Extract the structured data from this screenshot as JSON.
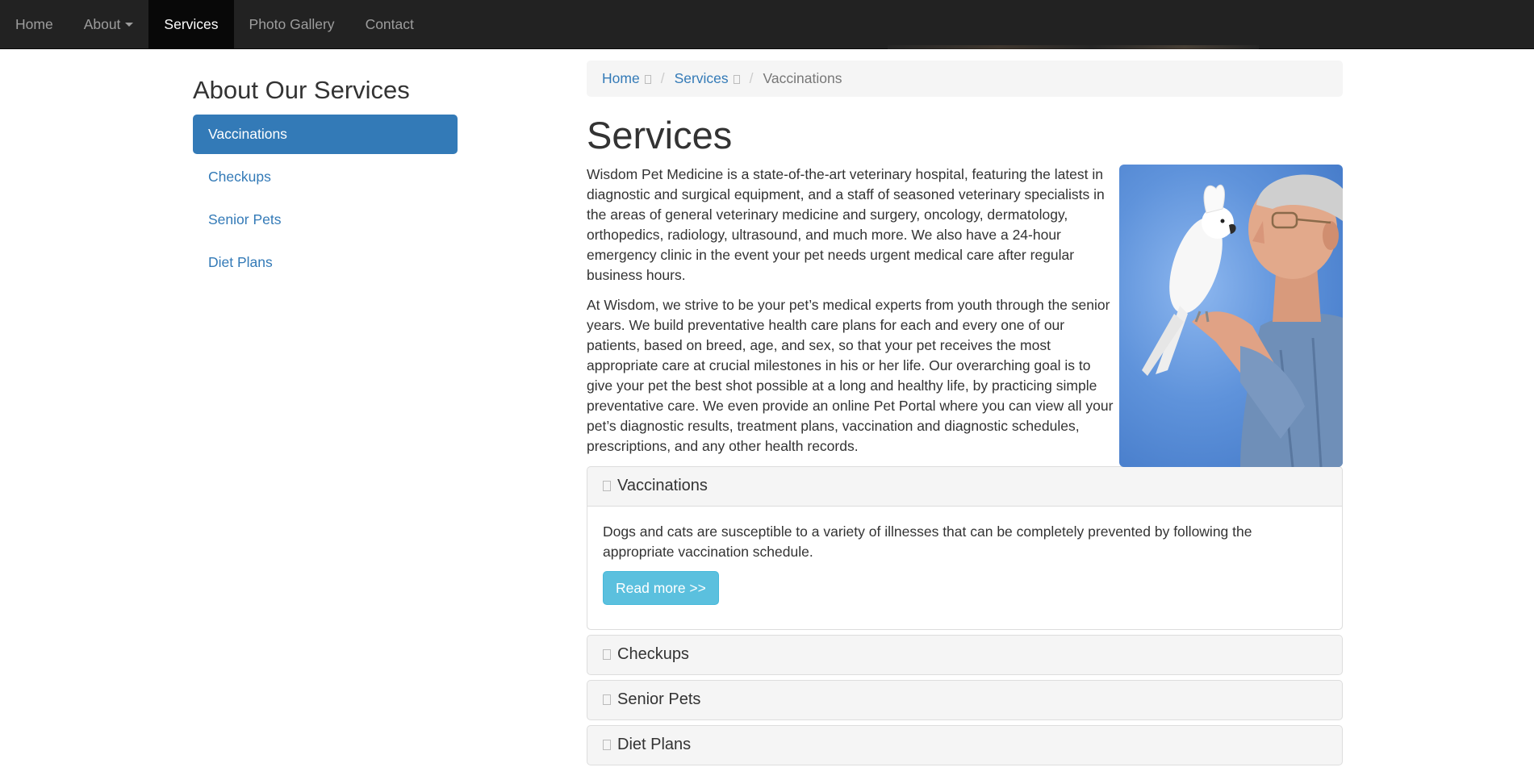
{
  "nav": {
    "items": [
      {
        "label": "Home"
      },
      {
        "label": "About"
      },
      {
        "label": "Services"
      },
      {
        "label": "Photo Gallery"
      },
      {
        "label": "Contact"
      }
    ],
    "active": "Services"
  },
  "sidebar": {
    "title": "About Our Services",
    "items": [
      {
        "label": "Vaccinations",
        "active": true
      },
      {
        "label": "Checkups"
      },
      {
        "label": "Senior Pets"
      },
      {
        "label": "Diet Plans"
      }
    ]
  },
  "breadcrumb": {
    "items": [
      "Home",
      "Services"
    ],
    "current": "Vaccinations"
  },
  "main": {
    "title": "Services",
    "paragraphs": [
      "Wisdom Pet Medicine is a state-of-the-art veterinary hospital, featuring the latest in diagnostic and surgical equipment, and a staff of seasoned veterinary specialists in the areas of general veterinary medicine and surgery, oncology, dermatology, orthopedics, radiology, ultrasound, and much more. We also have a 24-hour emergency clinic in the event your pet needs urgent medical care after regular business hours.",
      "At Wisdom, we strive to be your pet’s medical experts from youth through the senior years. We build preventative health care plans for each and every one of our patients, based on breed, age, and sex, so that your pet receives the most appropriate care at crucial milestones in his or her life. Our overarching goal is to give your pet the best shot possible at a long and healthy life, by practicing simple preventative care. We even provide an online Pet Portal where you can view all your pet’s diagnostic results, treatment plans, vaccination and diagnostic schedules, prescriptions, and any other health records."
    ]
  },
  "accordion": [
    {
      "title": "Vaccinations",
      "expanded": true,
      "body": "Dogs and cats are susceptible to a variety of illnesses that can be completely prevented by following the appropriate vaccination schedule.",
      "button": "Read more >>"
    },
    {
      "title": "Checkups",
      "expanded": false
    },
    {
      "title": "Senior Pets",
      "expanded": false
    },
    {
      "title": "Diet Plans",
      "expanded": false
    }
  ],
  "colors": {
    "navbar_bg": "#222222",
    "link": "#337ab7",
    "button_info": "#5bc0de"
  },
  "icons": [
    "caret-down-icon",
    "bookmark-icon",
    "chevron-icon"
  ]
}
